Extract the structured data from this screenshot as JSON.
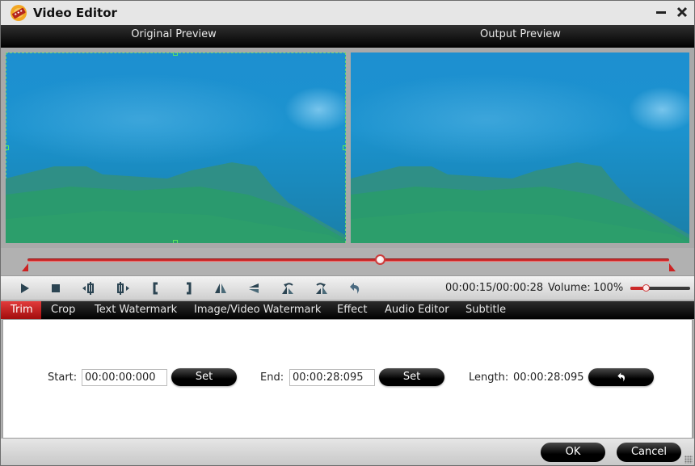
{
  "window": {
    "title": "Video Editor",
    "icon": "film-reel-icon",
    "minimize_icon": "minimize-icon",
    "close_icon": "close-icon"
  },
  "preview": {
    "original_label": "Original Preview",
    "output_label": "Output Preview",
    "position_fraction": 0.55
  },
  "toolbar": {
    "buttons": [
      {
        "name": "play",
        "icon": "play-icon"
      },
      {
        "name": "stop",
        "icon": "stop-icon"
      },
      {
        "name": "previous-frame",
        "icon": "previous-frame-icon"
      },
      {
        "name": "next-frame",
        "icon": "next-frame-icon"
      },
      {
        "name": "set-start",
        "icon": "left-bracket-icon"
      },
      {
        "name": "set-end",
        "icon": "right-bracket-icon"
      },
      {
        "name": "flip-horizontal",
        "icon": "flip-horizontal-icon"
      },
      {
        "name": "flip-vertical",
        "icon": "flip-vertical-icon"
      },
      {
        "name": "rotate-left",
        "icon": "rotate-left-icon"
      },
      {
        "name": "rotate-right",
        "icon": "rotate-right-icon"
      },
      {
        "name": "reset",
        "icon": "undo-icon"
      }
    ],
    "time": "00:00:15/00:00:28",
    "volume_label": "Volume:",
    "volume_value": "100%",
    "volume_fraction": 0.25
  },
  "tabs": [
    {
      "label": "Trim",
      "active": true
    },
    {
      "label": "Crop",
      "active": false
    },
    {
      "label": "Text Watermark",
      "active": false
    },
    {
      "label": "Image/Video Watermark",
      "active": false
    },
    {
      "label": "Effect",
      "active": false
    },
    {
      "label": "Audio Editor",
      "active": false
    },
    {
      "label": "Subtitle",
      "active": false
    }
  ],
  "trim": {
    "start_label": "Start:",
    "start_value": "00:00:00:000",
    "start_set_label": "Set",
    "end_label": "End:",
    "end_value": "00:00:28:095",
    "end_set_label": "Set",
    "length_label": "Length:",
    "length_value": "00:00:28:095",
    "reset_icon": "undo-icon"
  },
  "footer": {
    "ok_label": "OK",
    "cancel_label": "Cancel"
  },
  "colors": {
    "accent": "#cc2a2a",
    "tab_active": "#c41f1f",
    "crop_frame": "#6cd66c"
  }
}
